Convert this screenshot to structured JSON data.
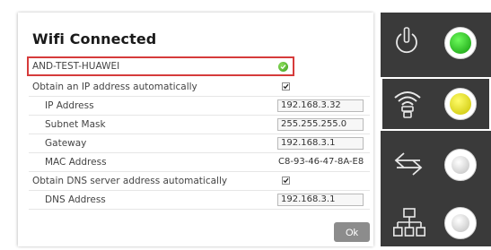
{
  "dialog": {
    "title": "Wifi Connected",
    "network_name": "AND-TEST-HUAWEI",
    "rows": {
      "obtain_ip_label": "Obtain an IP address automatically",
      "ip_label": "IP Address",
      "ip_value": "192.168.3.32",
      "subnet_label": "Subnet Mask",
      "subnet_value": "255.255.255.0",
      "gateway_label": "Gateway",
      "gateway_value": "192.168.3.1",
      "mac_label": "MAC Address",
      "mac_value": "C8-93-46-47-8A-E8",
      "obtain_dns_label": "Obtain DNS server address automatically",
      "dns_label": "DNS Address",
      "dns_value": "192.168.3.1"
    },
    "ok_label": "Ok"
  },
  "panel": {
    "items": [
      {
        "icon": "power-icon",
        "status_color": "#22b51a"
      },
      {
        "icon": "wifi-icon",
        "status_color": "#e5e300"
      },
      {
        "icon": "transfer-arrows-icon",
        "status_color": "#cfcfcf"
      },
      {
        "icon": "network-tree-icon",
        "status_color": "#cfcfcf"
      }
    ]
  },
  "colors": {
    "highlight_border": "#d63b3b",
    "panel_bg": "#3a3a3a",
    "ok_button": "#8c8c8c",
    "connected_green": "#3b9c1c"
  }
}
